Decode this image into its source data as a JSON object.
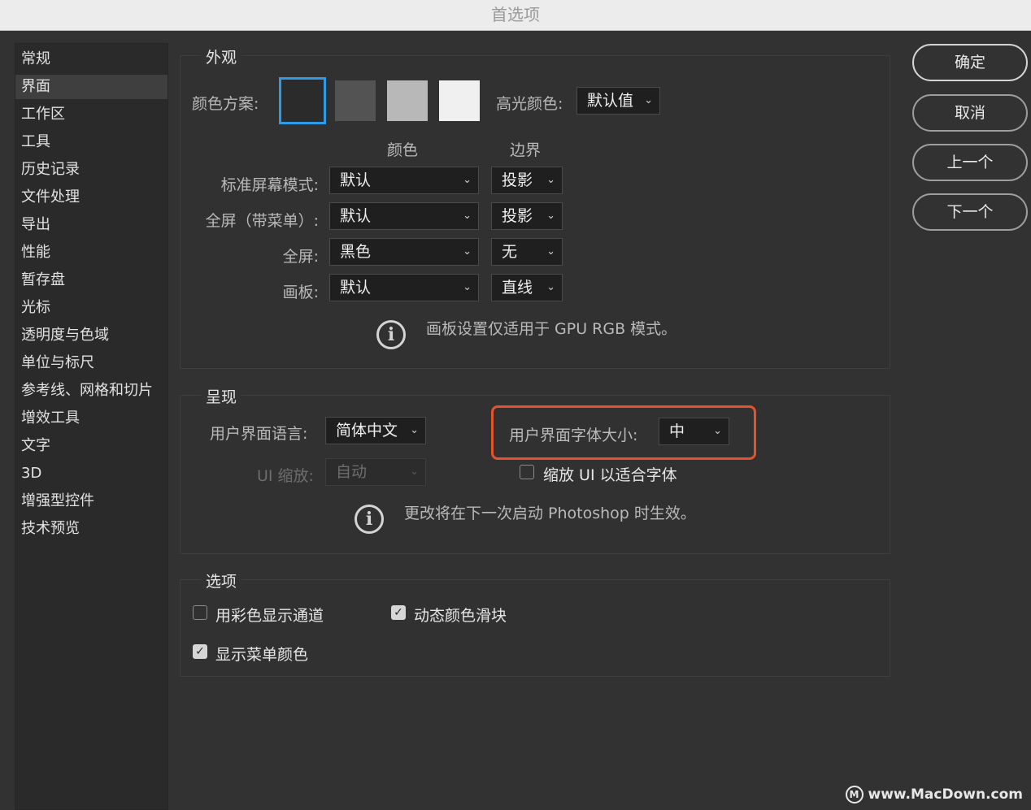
{
  "window": {
    "title": "首选项"
  },
  "sidebar": {
    "active_index": 1,
    "items": [
      {
        "label": "常规"
      },
      {
        "label": "界面"
      },
      {
        "label": "工作区"
      },
      {
        "label": "工具"
      },
      {
        "label": "历史记录"
      },
      {
        "label": "文件处理"
      },
      {
        "label": "导出"
      },
      {
        "label": "性能"
      },
      {
        "label": "暂存盘"
      },
      {
        "label": "光标"
      },
      {
        "label": "透明度与色域"
      },
      {
        "label": "单位与标尺"
      },
      {
        "label": "参考线、网格和切片"
      },
      {
        "label": "增效工具"
      },
      {
        "label": "文字"
      },
      {
        "label": "3D"
      },
      {
        "label": "增强型控件"
      },
      {
        "label": "技术预览"
      }
    ]
  },
  "appearance": {
    "title": "外观",
    "color_scheme_label": "颜色方案:",
    "swatch_colors": [
      "#2b2b2b",
      "#535353",
      "#b8b8b8",
      "#f0f0f0"
    ],
    "selected_swatch": 0,
    "selected_border_color": "#2f9be6",
    "highlight_label": "高光颜色:",
    "highlight_value": "默认值",
    "col_color": "颜色",
    "col_border": "边界",
    "rows": [
      {
        "label": "标准屏幕模式:",
        "color": "默认",
        "border": "投影"
      },
      {
        "label": "全屏（带菜单）:",
        "color": "默认",
        "border": "投影"
      },
      {
        "label": "全屏:",
        "color": "黑色",
        "border": "无"
      },
      {
        "label": "画板:",
        "color": "默认",
        "border": "直线"
      }
    ],
    "note": "画板设置仅适用于 GPU RGB 模式。"
  },
  "presentation": {
    "title": "呈现",
    "ui_language_label": "用户界面语言:",
    "ui_language_value": "简体中文",
    "ui_font_size_label": "用户界面字体大小:",
    "ui_font_size_value": "中",
    "ui_scale_label": "UI 缩放:",
    "ui_scale_value": "自动",
    "scale_to_font_label": "缩放 UI 以适合字体",
    "scale_to_font_checked": false,
    "note": "更改将在下一次启动 Photoshop 时生效。",
    "highlight_color": "#e4532e"
  },
  "options": {
    "title": "选项",
    "items": [
      {
        "label": "用彩色显示通道",
        "checked": false
      },
      {
        "label": "动态颜色滑块",
        "checked": true
      },
      {
        "label": "显示菜单颜色",
        "checked": true
      }
    ]
  },
  "buttons": {
    "ok": "确定",
    "cancel": "取消",
    "prev": "上一个",
    "next": "下一个"
  },
  "icons": {
    "info": "ⓘ",
    "chevron": "⌄",
    "check": "✓"
  },
  "watermark": {
    "logo": "M",
    "text": "www.MacDown.com"
  }
}
